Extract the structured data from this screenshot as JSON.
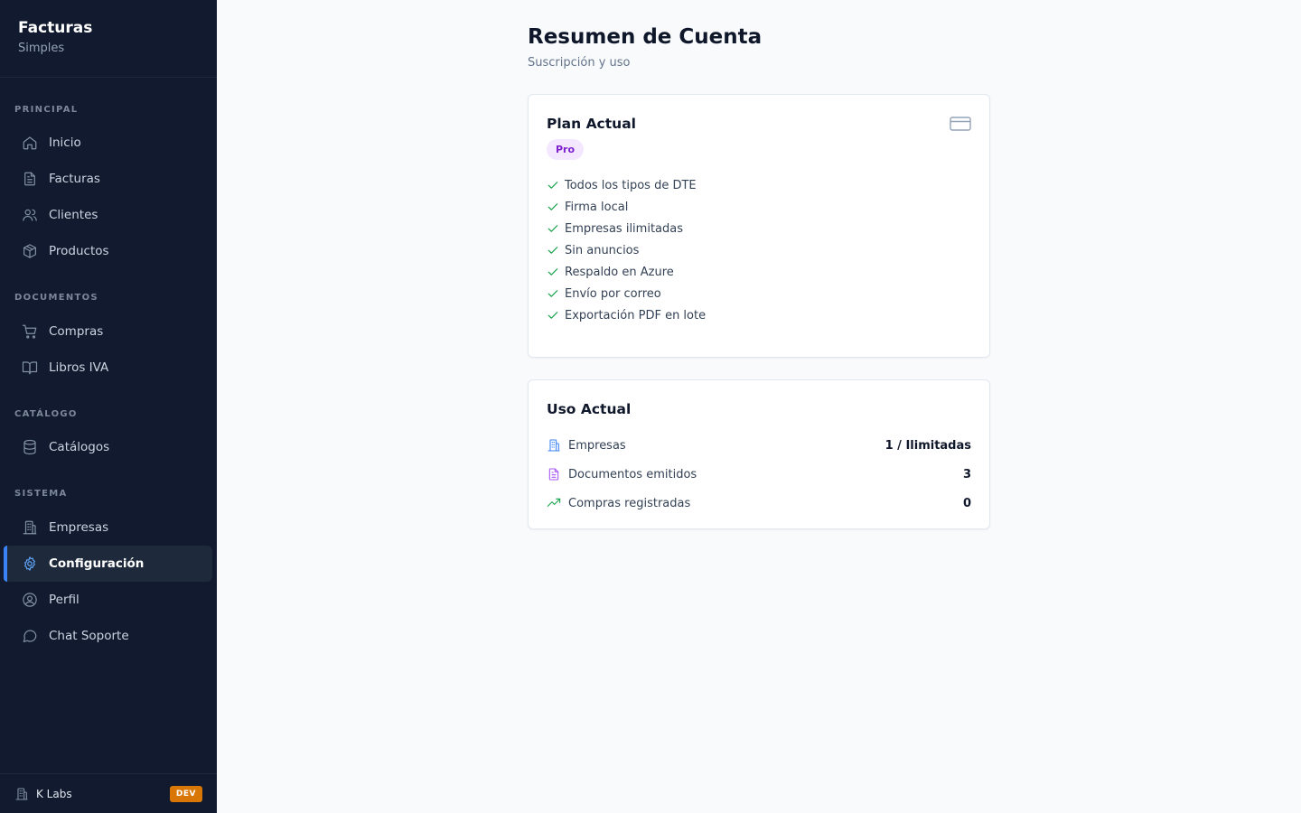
{
  "brand": {
    "title": "Facturas",
    "subtitle": "Simples"
  },
  "sidebar": {
    "sections": [
      {
        "label": "PRINCIPAL"
      },
      {
        "label": "DOCUMENTOS"
      },
      {
        "label": "CATÁLOGO"
      },
      {
        "label": "SISTEMA"
      }
    ],
    "items": [
      {
        "label": "Inicio",
        "icon": "home-icon"
      },
      {
        "label": "Facturas",
        "icon": "file-text-icon"
      },
      {
        "label": "Clientes",
        "icon": "users-icon"
      },
      {
        "label": "Productos",
        "icon": "box-icon"
      },
      {
        "label": "Compras",
        "icon": "cart-icon"
      },
      {
        "label": "Libros IVA",
        "icon": "book-icon"
      },
      {
        "label": "Catálogos",
        "icon": "database-icon"
      },
      {
        "label": "Empresas",
        "icon": "building-icon"
      },
      {
        "label": "Configuración",
        "icon": "gear-icon",
        "active": true
      },
      {
        "label": "Perfil",
        "icon": "user-circle-icon"
      },
      {
        "label": "Chat Soporte",
        "icon": "chat-icon"
      }
    ],
    "footer": {
      "org": "K Labs",
      "env_badge": "DEV"
    }
  },
  "page": {
    "title": "Resumen de Cuenta",
    "subtitle": "Suscripción y uso"
  },
  "plan": {
    "title": "Plan Actual",
    "badge": "Pro",
    "features": [
      "Todos los tipos de DTE",
      "Firma local",
      "Empresas ilimitadas",
      "Sin anuncios",
      "Respaldo en Azure",
      "Envío por correo",
      "Exportación PDF en lote"
    ]
  },
  "usage": {
    "title": "Uso Actual",
    "rows": [
      {
        "label": "Empresas",
        "value": "1 / Ilimitadas",
        "icon": "building-icon"
      },
      {
        "label": "Documentos emitidos",
        "value": "3",
        "icon": "file-text-icon"
      },
      {
        "label": "Compras registradas",
        "value": "0",
        "icon": "trending-up-icon"
      }
    ]
  },
  "colors": {
    "sidebar_bg": "#111a2e",
    "accent": "#3b82f6",
    "success": "#16a34a",
    "pro_badge": "#7e22ce",
    "dev_badge": "#d97706"
  }
}
